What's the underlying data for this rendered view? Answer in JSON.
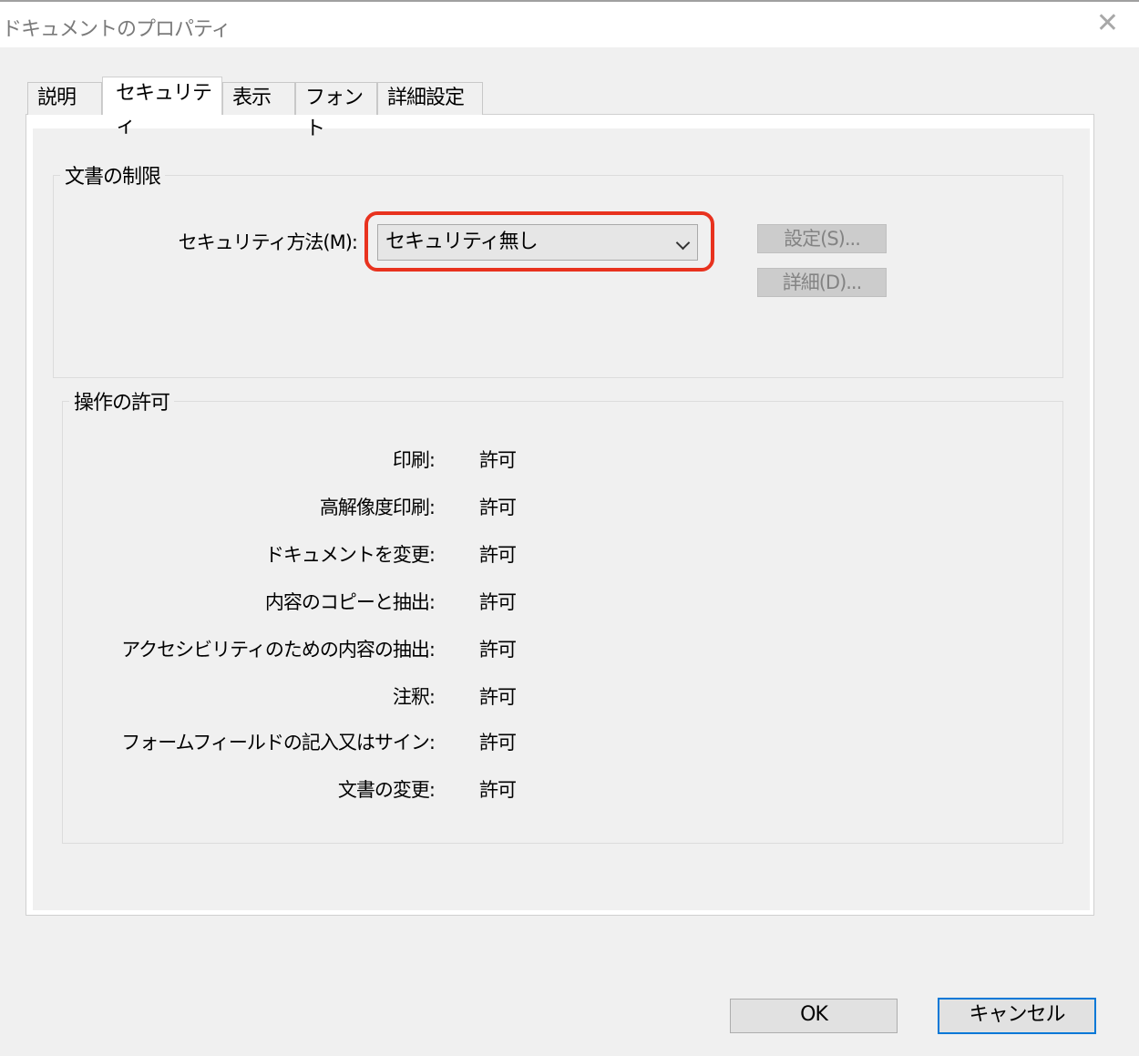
{
  "window": {
    "title": "ドキュメントのプロパティ",
    "close_glyph": "✕"
  },
  "tabs": [
    "説明",
    "セキュリティ",
    "表示",
    "フォント",
    "詳細設定"
  ],
  "active_tab": "セキュリティ",
  "restrictions": {
    "legend": "文書の制限",
    "method_label": "セキュリティ方法(M):",
    "method_value": "セキュリティ無し",
    "settings_button": "設定(S)...",
    "details_button": "詳細(D)..."
  },
  "permissions": {
    "legend": "操作の許可",
    "rows": [
      {
        "label": "印刷:",
        "value": "許可"
      },
      {
        "label": "高解像度印刷:",
        "value": "許可"
      },
      {
        "label": "ドキュメントを変更:",
        "value": "許可"
      },
      {
        "label": "内容のコピーと抽出:",
        "value": "許可"
      },
      {
        "label": "アクセシビリティのための内容の抽出:",
        "value": "許可"
      },
      {
        "label": "注釈:",
        "value": "許可"
      },
      {
        "label": "フォームフィールドの記入又はサイン:",
        "value": "許可"
      },
      {
        "label": "文書の変更:",
        "value": "許可"
      }
    ]
  },
  "footer": {
    "ok": "OK",
    "cancel": "キャンセル"
  },
  "colors": {
    "highlight": "#e8321e",
    "default_button_border": "#0078d7"
  }
}
